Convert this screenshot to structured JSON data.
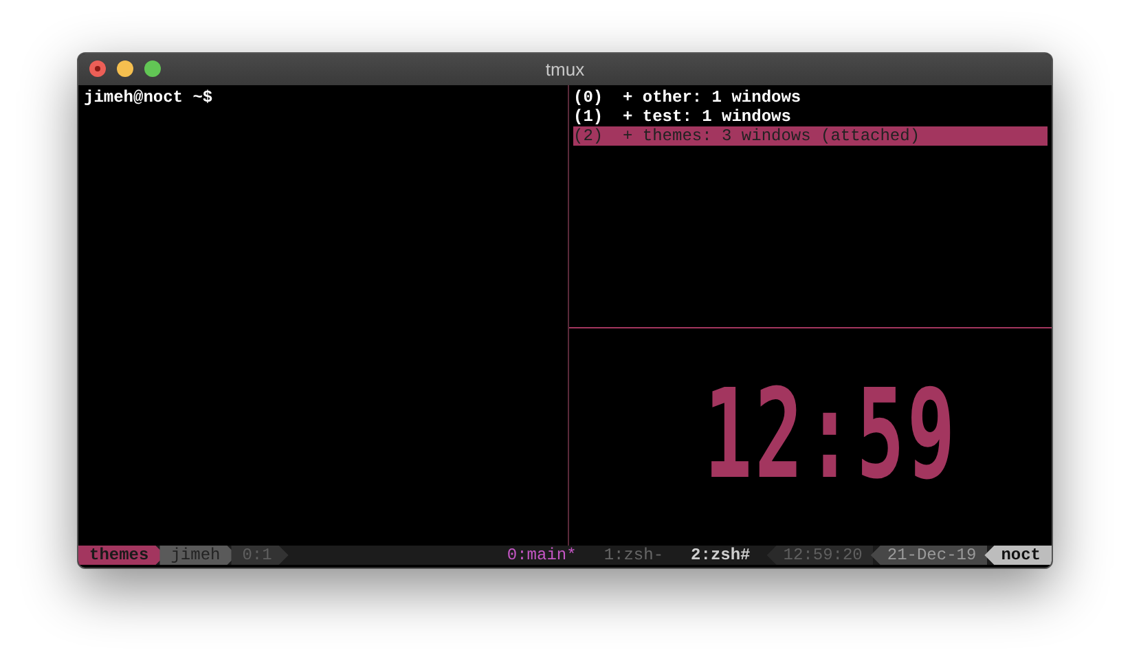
{
  "window": {
    "title": "tmux"
  },
  "left_pane": {
    "prompt": "jimeh@noct ~$"
  },
  "sessions": [
    {
      "index": "(0)",
      "label": "+ other: 1 windows",
      "selected": false
    },
    {
      "index": "(1)",
      "label": "+ test: 1 windows",
      "selected": false
    },
    {
      "index": "(2)",
      "label": "+ themes: 3 windows (attached)",
      "selected": true
    }
  ],
  "clock": {
    "time": "12:59"
  },
  "status_bar": {
    "left": [
      {
        "text": "themes",
        "kind": "session"
      },
      {
        "text": "jimeh",
        "kind": "user"
      },
      {
        "text": "0:1",
        "kind": "pane"
      }
    ],
    "windows": [
      {
        "label": "0:main*",
        "selected": true,
        "activity": false
      },
      {
        "label": "1:zsh-",
        "selected": false,
        "activity": false
      },
      {
        "label": "2:zsh#",
        "selected": false,
        "activity": true
      }
    ],
    "right": [
      {
        "text": "12:59:20",
        "kind": "time"
      },
      {
        "text": "21-Dec-19",
        "kind": "date"
      },
      {
        "text": "noct",
        "kind": "host"
      }
    ]
  }
}
